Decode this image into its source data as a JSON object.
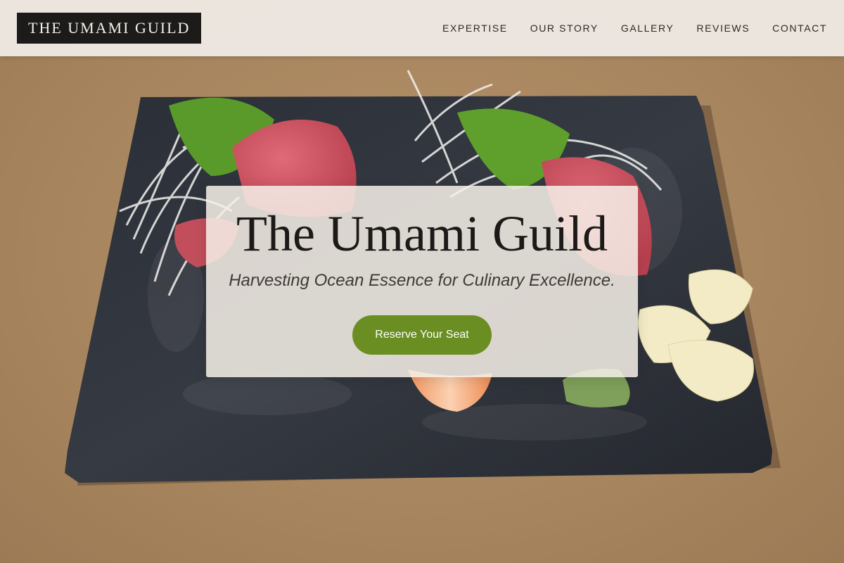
{
  "brand": {
    "logo_text": "THE UMAMI GUILD"
  },
  "nav": {
    "items": [
      {
        "label": "EXPERTISE"
      },
      {
        "label": "OUR STORY"
      },
      {
        "label": "GALLERY"
      },
      {
        "label": "REVIEWS"
      },
      {
        "label": "CONTACT"
      }
    ]
  },
  "hero": {
    "title": "The Umami Guild",
    "subtitle": "Harvesting Ocean Essence for Culinary Excellence.",
    "cta_label": "Reserve Your Seat",
    "background_image": "sashimi-platter-image"
  },
  "colors": {
    "accent": "#6b8e23",
    "logo_bg": "#1d1b19",
    "nav_bg": "#eee9e4",
    "card_bg": "#f6f0e8",
    "slate": "#2c3038",
    "tabletop": "#a8865f"
  }
}
